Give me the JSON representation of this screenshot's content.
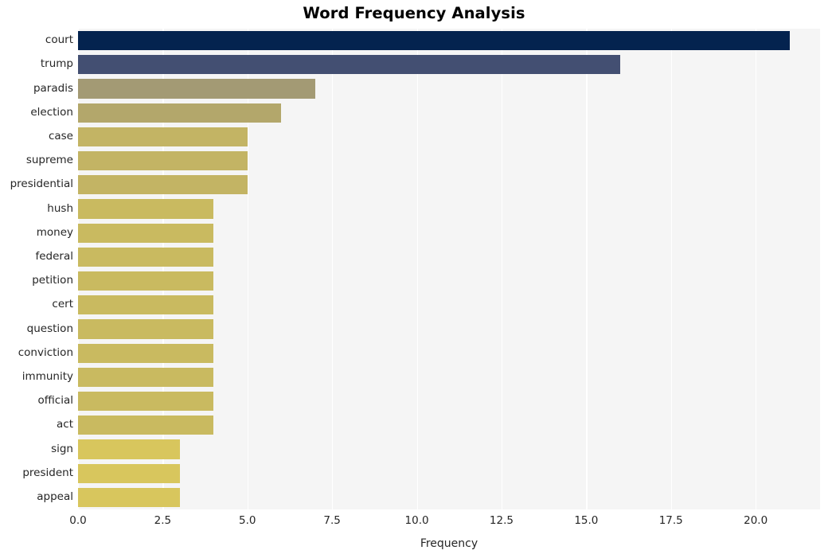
{
  "chart_data": {
    "type": "bar",
    "orientation": "horizontal",
    "title": "Word Frequency Analysis",
    "xlabel": "Frequency",
    "ylabel": "",
    "categories": [
      "court",
      "trump",
      "paradis",
      "election",
      "case",
      "supreme",
      "presidential",
      "hush",
      "money",
      "federal",
      "petition",
      "cert",
      "question",
      "conviction",
      "immunity",
      "official",
      "act",
      "sign",
      "president",
      "appeal"
    ],
    "values": [
      21,
      16,
      7,
      6,
      5,
      5,
      5,
      4,
      4,
      4,
      4,
      4,
      4,
      4,
      4,
      4,
      4,
      3,
      3,
      3
    ],
    "bar_colors": [
      "#04234f",
      "#434f72",
      "#a39a74",
      "#b3a76b",
      "#c3b464",
      "#c3b464",
      "#c3b464",
      "#c9ba60",
      "#c9ba60",
      "#c9ba60",
      "#c9ba60",
      "#c9ba60",
      "#c9ba60",
      "#c9ba60",
      "#c9ba60",
      "#c9ba60",
      "#c9ba60",
      "#d8c65d",
      "#d8c65d",
      "#d8c65d"
    ],
    "xticks": [
      "0.0",
      "2.5",
      "5.0",
      "7.5",
      "10.0",
      "12.5",
      "15.0",
      "17.5",
      "20.0"
    ],
    "xtick_values": [
      0.0,
      2.5,
      5.0,
      7.5,
      10.0,
      12.5,
      15.0,
      17.5,
      20.0
    ],
    "xlim": [
      0,
      21.9
    ],
    "grid": "vertical-white",
    "legend": "none",
    "plot_background": "#f5f5f5",
    "figure_background": "#ffffff",
    "title_color": "#000000",
    "tick_color": "#262626"
  }
}
